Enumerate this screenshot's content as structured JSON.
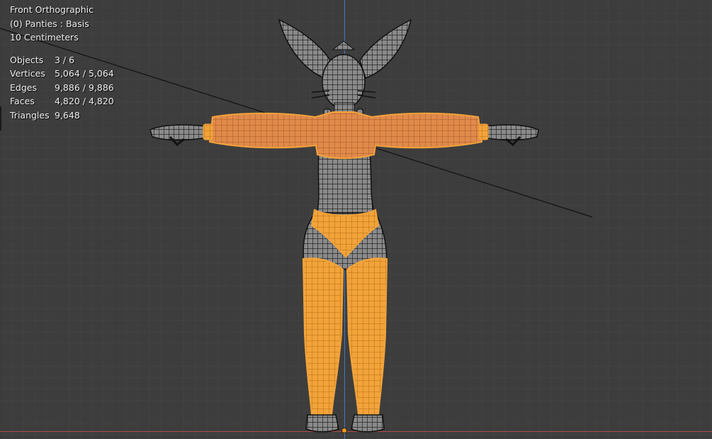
{
  "viewport": {
    "view_name": "Front Orthographic",
    "active_object": "(0) Panties : Basis",
    "grid_scale": "10 Centimeters"
  },
  "stats": [
    {
      "label": "Objects",
      "value": "3 / 6"
    },
    {
      "label": "Vertices",
      "value": "5,064 / 5,064"
    },
    {
      "label": "Edges",
      "value": "9,886 / 9,886"
    },
    {
      "label": "Faces",
      "value": "4,820 / 4,820"
    },
    {
      "label": "Triangles",
      "value": "9,648"
    }
  ],
  "colors": {
    "background": "#3d3d3d",
    "selected_mesh": "#f2a33a",
    "unselected_wire": "#1a1a1a",
    "axis_y": "#3f78b8",
    "axis_x": "#b34a4a",
    "origin_dot": "#ff9a1a"
  }
}
